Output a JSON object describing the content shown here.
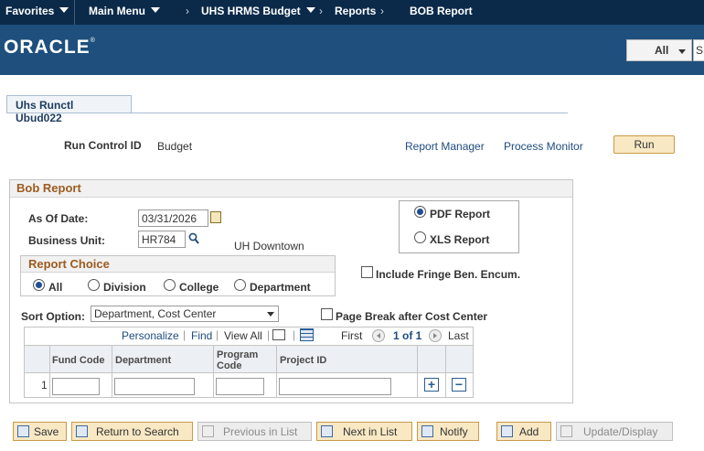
{
  "nav": {
    "favorites": "Favorites",
    "main_menu": "Main Menu",
    "breadcrumbs": [
      "UHS HRMS Budget",
      "Reports",
      "BOB Report"
    ]
  },
  "brand": {
    "logo": "ORACLE",
    "search_scope": "All",
    "search_value": "S"
  },
  "tab": {
    "label": "Uhs Runctl Ubud022"
  },
  "run": {
    "run_control_label": "Run Control ID",
    "run_control_value": "Budget",
    "report_manager": "Report Manager",
    "process_monitor": "Process Monitor",
    "run_button": "Run"
  },
  "section": {
    "title": "Bob Report"
  },
  "form": {
    "as_of_label": "As Of Date:",
    "as_of_value": "03/31/2026",
    "bu_label": "Business Unit:",
    "bu_value": "HR784",
    "bu_desc": "UH Downtown",
    "format_pdf": "PDF Report",
    "format_xls": "XLS Report",
    "format_selected": "PDF Report",
    "fringe_label": "Include Fringe Ben. Encum.",
    "fringe_checked": false,
    "choice_title": "Report Choice",
    "choices": [
      "All",
      "Division",
      "College",
      "Department"
    ],
    "choice_selected": "All",
    "sort_label": "Sort Option:",
    "sort_value": "Department, Cost Center",
    "pagebreak_label": "Page Break after Cost Center",
    "pagebreak_checked": false
  },
  "grid": {
    "personalize": "Personalize",
    "find": "Find",
    "view_all": "View All",
    "first": "First",
    "range": "1 of 1",
    "last": "Last",
    "columns": [
      "Fund Code",
      "Department",
      "Program Code",
      "Project ID"
    ],
    "rows": [
      {
        "num": "1",
        "fund_code": "",
        "department": "",
        "program_code": "",
        "project_id": ""
      }
    ]
  },
  "toolbar": {
    "save": "Save",
    "return_to_search": "Return to Search",
    "previous_in_list": "Previous in List",
    "next_in_list": "Next in List",
    "notify": "Notify",
    "add": "Add",
    "update_display": "Update/Display"
  },
  "colors": {
    "nav_bg": "#0b2a4a",
    "banner_bg": "#1e4f7d",
    "section_title": "#9c5b20",
    "button_bg": "#f8e8c4"
  }
}
